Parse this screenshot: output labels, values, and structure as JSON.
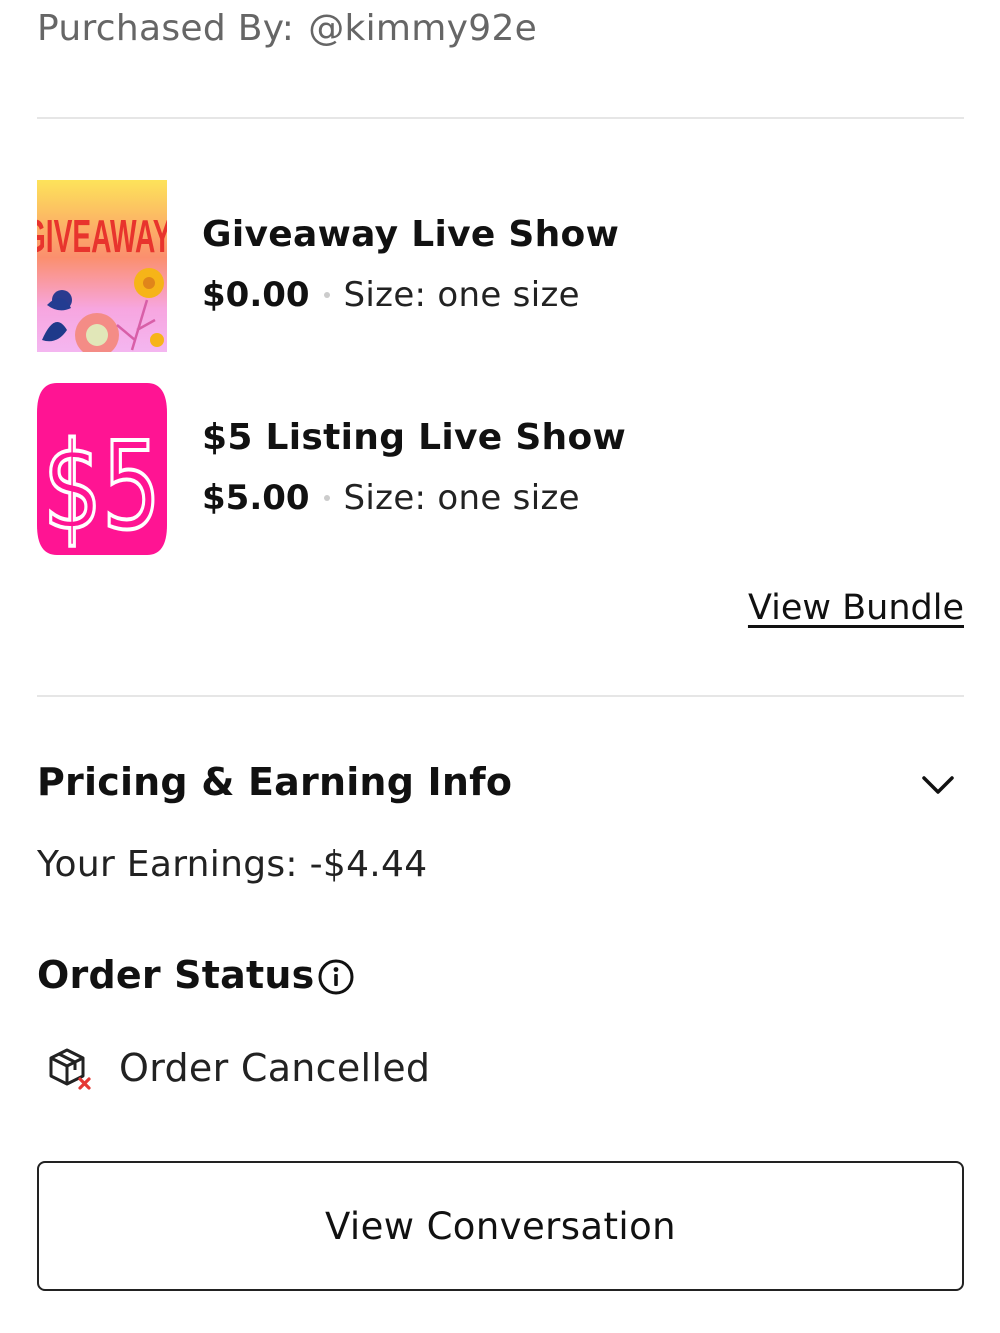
{
  "purchased": {
    "label": "Purchased By:",
    "handle": "@kimmy92e"
  },
  "items": [
    {
      "title": "Giveaway Live Show",
      "price": "$0.00",
      "size": "Size: one size",
      "image_text": "GIVEAWAY",
      "image_icon": "giveaway-flowers-image"
    },
    {
      "title": "$5 Listing Live Show",
      "price": "$5.00",
      "size": "Size: one size",
      "image_text": "$5",
      "image_icon": "five-dollar-image"
    }
  ],
  "view_bundle_label": "View Bundle",
  "pricing": {
    "title": "Pricing & Earning Info",
    "earnings": "Your Earnings: -$4.44"
  },
  "order_status": {
    "title": "Order Status",
    "status": "Order Cancelled",
    "status_icon": "package-cancelled-icon"
  },
  "view_conversation_label": "View Conversation",
  "colors": {
    "divider": "#e6e6e6",
    "pink": "#ff1493",
    "cancel_red": "#e53935",
    "muted_text": "#666666"
  }
}
